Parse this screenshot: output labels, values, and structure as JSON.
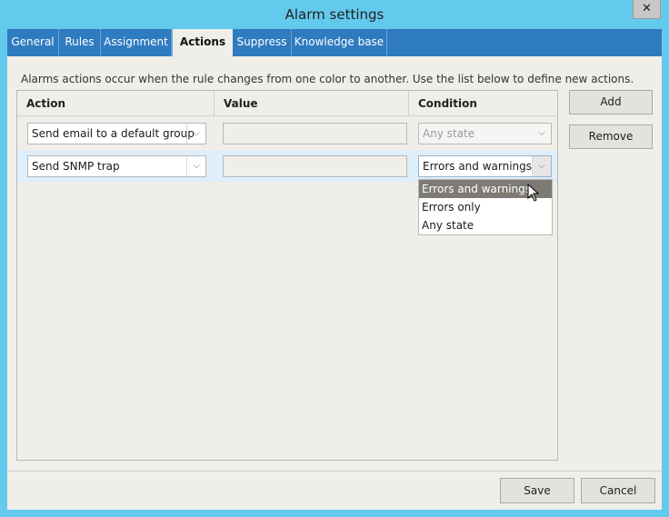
{
  "window": {
    "title": "Alarm settings",
    "close_glyph": "✕"
  },
  "tabs": [
    {
      "label": "General"
    },
    {
      "label": "Rules"
    },
    {
      "label": "Assignment"
    },
    {
      "label": "Actions",
      "active": true
    },
    {
      "label": "Suppress"
    },
    {
      "label": "Knowledge base"
    }
  ],
  "description": "Alarms actions occur when the rule changes from one color to another. Use the list below to define new actions.",
  "grid": {
    "headers": [
      "Action",
      "Value",
      "Condition"
    ],
    "rows": [
      {
        "action": "Send email to a default group",
        "value": "",
        "condition": "Any state",
        "condition_disabled": true
      },
      {
        "action": "Send SNMP trap",
        "value": "",
        "condition": "Errors and warnings",
        "selected": true
      }
    ]
  },
  "dropdown": {
    "options": [
      "Errors and warnings",
      "Errors only",
      "Any state"
    ],
    "highlighted": 0
  },
  "side_buttons": {
    "add": "Add",
    "remove": "Remove"
  },
  "footer": {
    "save": "Save",
    "cancel": "Cancel"
  },
  "icons": {
    "combo_arrow": "chevron-down-icon",
    "cursor": "mouse-pointer-icon",
    "close": "close-icon"
  },
  "colors": {
    "title_bar": "#64caed",
    "tab_bar": "#2f7bbf",
    "panel": "#efeee8",
    "selected_row": "#deeefa",
    "highlight_option": "#7d7b72"
  }
}
